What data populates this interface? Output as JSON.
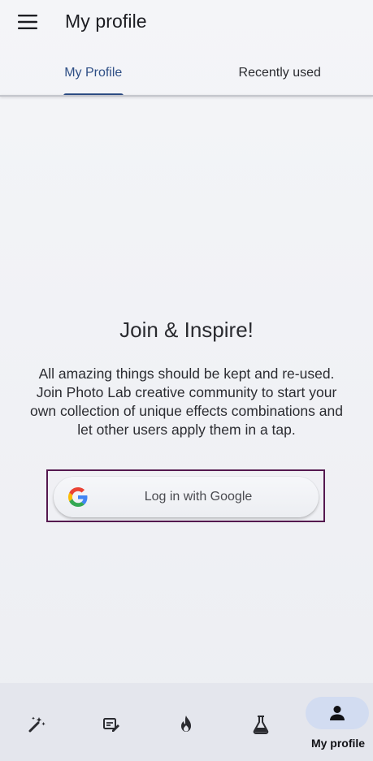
{
  "app_bar": {
    "title": "My profile",
    "menu_icon": "hamburger-menu-icon"
  },
  "tabs": [
    {
      "label": "My Profile",
      "active": true
    },
    {
      "label": "Recently used",
      "active": false
    }
  ],
  "content": {
    "heading": "Join & Inspire!",
    "description": "All amazing things should be kept and re-used. Join Photo Lab creative community to start your own collection of unique effects combinations and let other users apply them in a tap.",
    "login_button": {
      "label": "Log in with Google",
      "icon": "google-logo-icon"
    }
  },
  "bottom_nav": {
    "items": [
      {
        "icon": "magic-wand-icon"
      },
      {
        "icon": "edit-image-icon"
      },
      {
        "icon": "fire-icon"
      },
      {
        "icon": "flask-icon"
      },
      {
        "icon": "person-icon",
        "label": "My profile",
        "active": true
      }
    ]
  },
  "colors": {
    "accent": "#2f4f86",
    "highlight_border": "#55184f",
    "nav_active_pill": "#d2dcf1",
    "background": "#eff0f4"
  }
}
